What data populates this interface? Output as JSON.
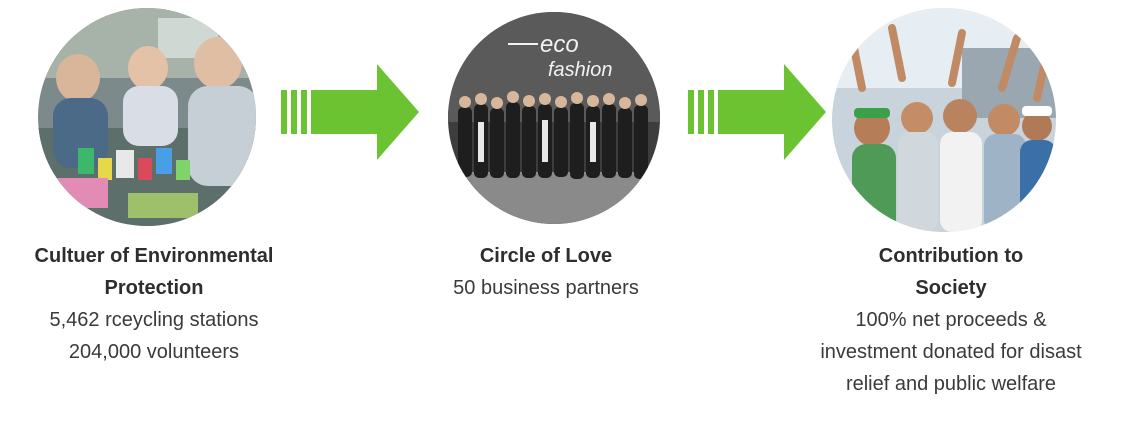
{
  "steps": [
    {
      "title_line1": "Cultuer of Environmental",
      "title_line2": "Protection",
      "detail_line1": "5,462 rceycling stations",
      "detail_line2": "204,000 volunteers"
    },
    {
      "title_line1": "Circle of Love",
      "detail_line1": "50 business partners",
      "banner_line1": "eco",
      "banner_line2": "fashion"
    },
    {
      "title_line1": "Contribution to",
      "title_line2": "Society",
      "detail_line1": "100% net proceeds &",
      "detail_line2": "investment donated for disast",
      "detail_line3": "relief and public welfare"
    }
  ],
  "colors": {
    "arrow_green": "#6cc332",
    "arrow_green_dark": "#4ea81e",
    "text": "#333333"
  },
  "icons": [
    "arrow-right-icon",
    "arrow-right-icon"
  ]
}
